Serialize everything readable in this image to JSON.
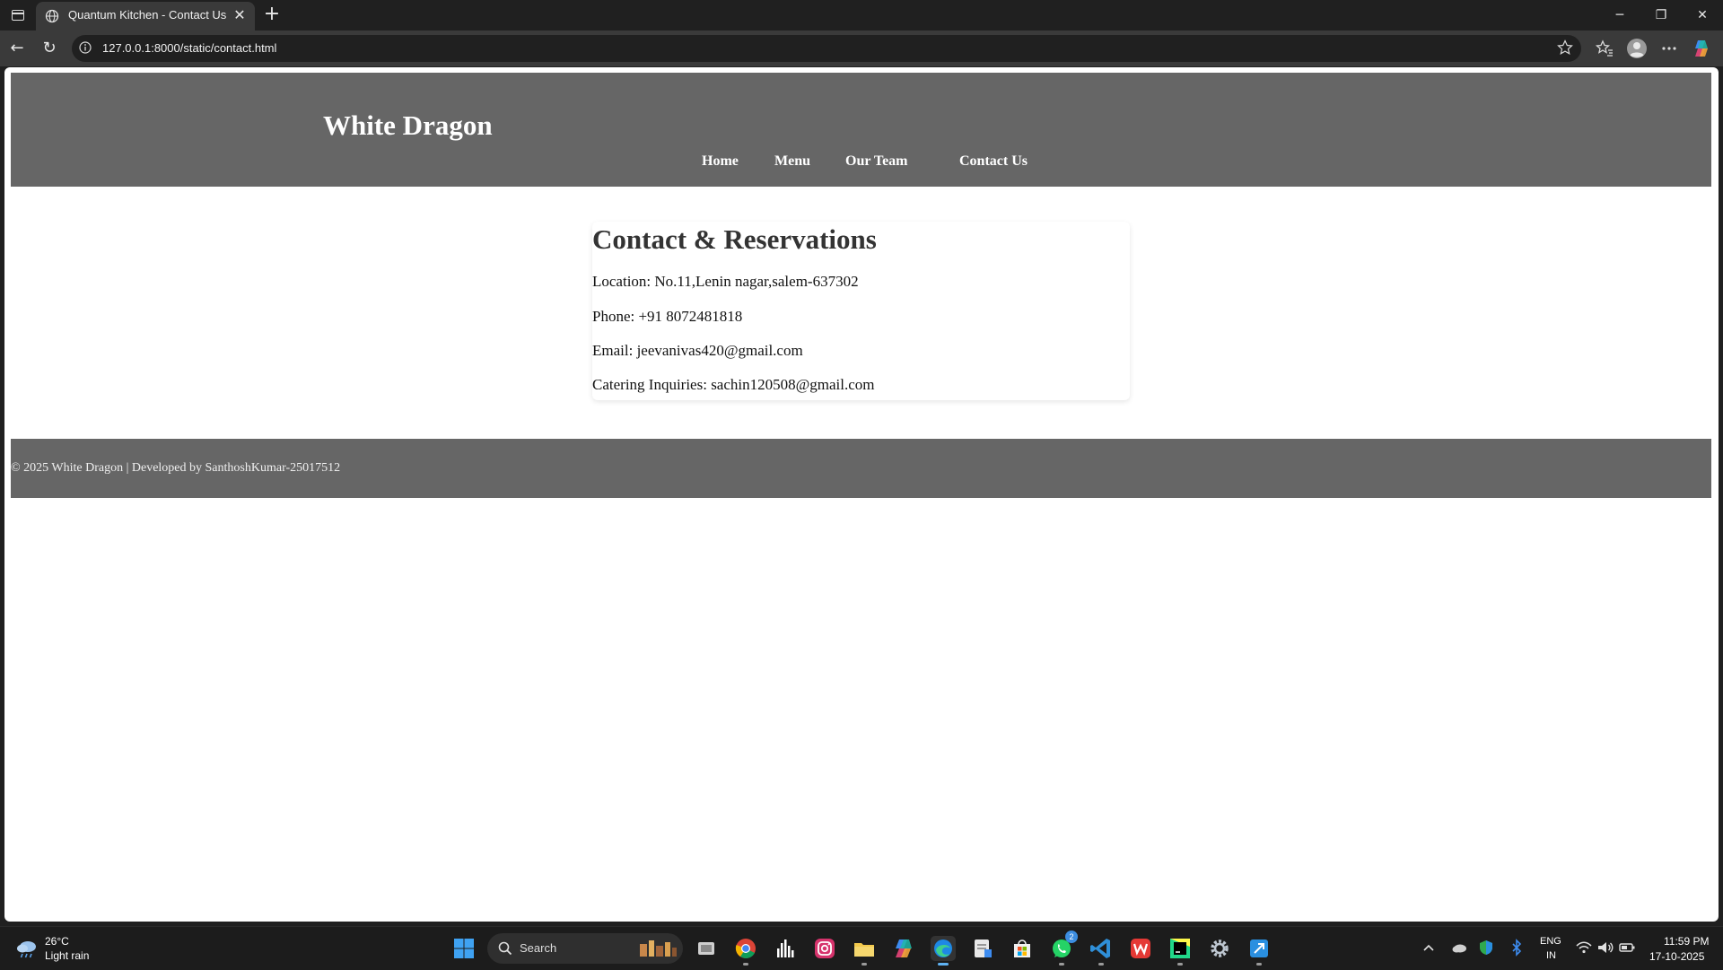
{
  "browser": {
    "tab_title": "Quantum Kitchen - Contact Us",
    "url": "127.0.0.1:8000/static/contact.html"
  },
  "site": {
    "logo": "White Dragon",
    "nav": [
      "Home",
      "Menu",
      "Our Team",
      "Contact Us"
    ],
    "heading": "Contact & Reservations",
    "contact_lines": [
      "Location: No.11,Lenin nagar,salem-637302",
      "Phone: +91 8072481818",
      "Email: jeevanivas420@gmail.com",
      "Catering Inquiries: sachin120508@gmail.com"
    ],
    "footer": "© 2025 White Dragon | Developed by SanthoshKumar-25017512",
    "colors": {
      "header_bg": "#666666",
      "footer_bg": "#666666",
      "heading": "#333333"
    }
  },
  "taskbar": {
    "weather_temp": "26°C",
    "weather_desc": "Light rain",
    "search_label": "Search",
    "whatsapp_badge": "2",
    "lang_line1": "ENG",
    "lang_line2": "IN",
    "time": "11:59 PM",
    "date": "17-10-2025",
    "apps": [
      "task-view",
      "chrome",
      "stocks",
      "instagram",
      "file-explorer",
      "copilot",
      "edge",
      "notepad",
      "store",
      "whatsapp",
      "vscode",
      "wps",
      "pycharm",
      "settings",
      "remote-desktop"
    ]
  }
}
